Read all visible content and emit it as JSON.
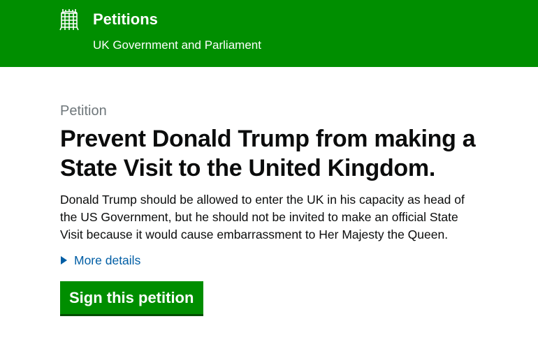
{
  "header": {
    "title": "Petitions",
    "subtitle": "UK Government and Parliament",
    "logo_icon": "portcullis-icon",
    "background_color": "#008e00"
  },
  "petition": {
    "caption": "Petition",
    "title": "Prevent Donald Trump from making a State Visit to the United Kingdom.",
    "summary": "Donald Trump should be allowed to enter the UK in his capacity as head of the US Government, but he should not be invited to make an official State Visit because it would cause embarrassment to Her Majesty the Queen.",
    "details_label": "More details",
    "details_icon": "triangle-right-icon",
    "sign_button_label": "Sign this petition",
    "link_color": "#005ea5",
    "button_color": "#008e00"
  }
}
